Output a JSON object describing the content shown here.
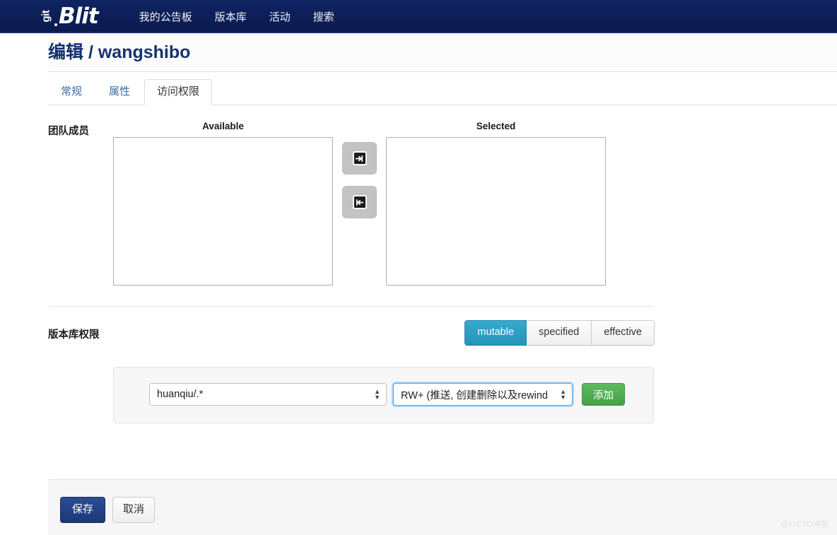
{
  "navbar": {
    "brand": {
      "git": "git",
      "blit": "Blit"
    },
    "links": [
      {
        "label": "我的公告板",
        "name": "nav-my-dashboard"
      },
      {
        "label": "版本库",
        "name": "nav-repositories"
      },
      {
        "label": "活动",
        "name": "nav-activity"
      },
      {
        "label": "搜索",
        "name": "nav-search"
      }
    ]
  },
  "header": {
    "title_prefix": "编辑",
    "title_separator": " / ",
    "title_name": "wangshibo"
  },
  "tabs": [
    {
      "label": "常规",
      "active": false
    },
    {
      "label": "属性",
      "active": false
    },
    {
      "label": "访问权限",
      "active": true
    }
  ],
  "teams": {
    "label": "团队成员",
    "available_heading": "Available",
    "selected_heading": "Selected",
    "available_items": [],
    "selected_items": [],
    "add_button_icon": "arrow-right-icon",
    "remove_button_icon": "arrow-left-icon"
  },
  "permissions": {
    "label": "版本库权限",
    "modes": [
      {
        "label": "mutable",
        "active": true
      },
      {
        "label": "specified",
        "active": false
      },
      {
        "label": "effective",
        "active": false
      }
    ],
    "active_color": "#2d9fc4",
    "repository_select": {
      "value": "huanqiu/.*",
      "options": [
        "huanqiu/.*"
      ]
    },
    "access_select": {
      "value": "RW+ (推送, 创建删除以及rewind",
      "options": [
        "RW+ (推送, 创建删除以及rewind"
      ]
    },
    "add_label": "添加"
  },
  "footer": {
    "save_label": "保存",
    "cancel_label": "取消",
    "save_color": "#23407f"
  },
  "watermark": {
    "text": "@51CTO博客"
  }
}
